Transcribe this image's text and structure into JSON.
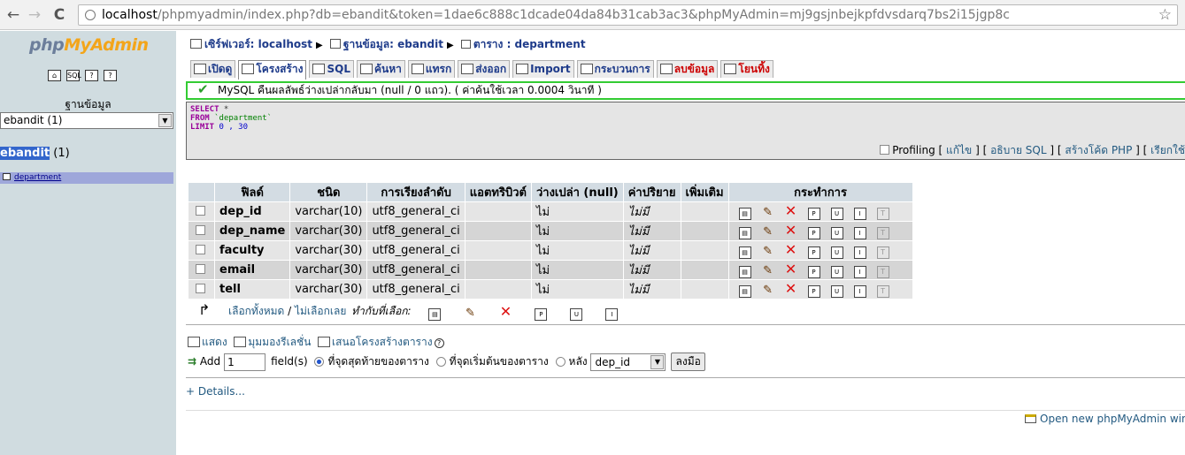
{
  "browser": {
    "back": "←",
    "forward": "→",
    "reload": "C",
    "url_host": "localhost",
    "url_rest": "/phpmyadmin/index.php?db=ebandit&token=1dae6c888c1dcade04da84b31cab3ac3&phpMyAdmin=mj9gsjnbejkpfdvsdarq7bs2i15jgp8c",
    "star": "☆"
  },
  "sidebar": {
    "logo_a": "php",
    "logo_b": "MyAdmin",
    "db_label": "ฐานข้อมูล",
    "db_select": "ebandit (1)",
    "db_name": "ebandit",
    "db_count": " (1)",
    "table_name": "department"
  },
  "breadcrumb": {
    "server": "เซิร์ฟเวอร์: localhost",
    "database": "ฐานข้อมูล: ebandit",
    "table": "ตาราง : department"
  },
  "tabs": [
    {
      "label": "เปิดดู"
    },
    {
      "label": "โครงสร้าง"
    },
    {
      "label": "SQL"
    },
    {
      "label": "ค้นหา"
    },
    {
      "label": "แทรก"
    },
    {
      "label": "ส่งออก"
    },
    {
      "label": "Import"
    },
    {
      "label": "กระบวนการ"
    },
    {
      "label": "ลบข้อมูล"
    },
    {
      "label": "โยนทิ้ง"
    }
  ],
  "message": "MySQL คืนผลลัพธ์ว่างเปล่ากลับมา (null / 0 แถว). ( ค่าค้นใช้เวลา 0.0004 วินาที )",
  "sql": {
    "select_kw": "SELECT",
    "select_rest": " *",
    "from_kw": "FROM",
    "from_rest": " `department`",
    "limit_kw": "LIMIT",
    "limit_rest": " 0 , 30"
  },
  "sql_links": {
    "profiling": "Profiling",
    "edit": "แก้ไข",
    "explain": "อธิบาย SQL",
    "php": "สร้างโค้ด PHP",
    "refresh": "เรียกใช้"
  },
  "table": {
    "headers": [
      "ฟิลด์",
      "ชนิด",
      "การเรียงลำดับ",
      "แอตทริบิวต์",
      "ว่างเปล่า (null)",
      "ค่าปริยาย",
      "เพิ่มเติม",
      "กระทำการ"
    ],
    "rows": [
      {
        "field": "dep_id",
        "type": "varchar(10)",
        "collation": "utf8_general_ci",
        "attributes": "",
        "null": "ไม่",
        "default": "ไม่มี",
        "extra": ""
      },
      {
        "field": "dep_name",
        "type": "varchar(30)",
        "collation": "utf8_general_ci",
        "attributes": "",
        "null": "ไม่",
        "default": "ไม่มี",
        "extra": ""
      },
      {
        "field": "faculty",
        "type": "varchar(30)",
        "collation": "utf8_general_ci",
        "attributes": "",
        "null": "ไม่",
        "default": "ไม่มี",
        "extra": ""
      },
      {
        "field": "email",
        "type": "varchar(30)",
        "collation": "utf8_general_ci",
        "attributes": "",
        "null": "ไม่",
        "default": "ไม่มี",
        "extra": ""
      },
      {
        "field": "tell",
        "type": "varchar(30)",
        "collation": "utf8_general_ci",
        "attributes": "",
        "null": "ไม่",
        "default": "ไม่มี",
        "extra": ""
      }
    ]
  },
  "select_all": {
    "check_all": "เลือกทั้งหมด",
    "uncheck_all": "ไม่เลือกเลย",
    "with_selected": "ทำกับที่เลือก:"
  },
  "print_row": {
    "print": "แสดง",
    "relation": "มุมมองรีเลชั่น",
    "propose": "เสนอโครงสร้างตาราง"
  },
  "add_row": {
    "add": "Add",
    "count": "1",
    "fields": "field(s)",
    "at_end": "ที่จุดสุดท้ายของตาราง",
    "at_beginning": "ที่จุดเริ่มต้นของตาราง",
    "after": "หลัง",
    "after_col": "dep_id",
    "go": "ลงมือ"
  },
  "details": "+ Details...",
  "new_window": "Open new phpMyAdmin window"
}
